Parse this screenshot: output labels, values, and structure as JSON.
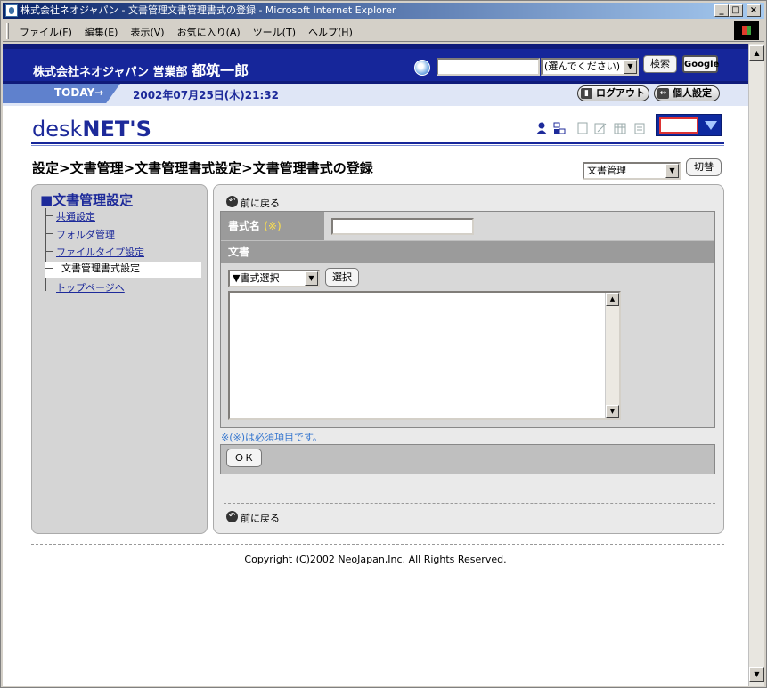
{
  "window": {
    "title": "株式会社ネオジャパン - 文書管理文書管理書式の登録 - Microsoft Internet Explorer",
    "minimize": "_",
    "maximize": "□",
    "close": "×"
  },
  "menubar": {
    "items": [
      "ファイル(F)",
      "編集(E)",
      "表示(V)",
      "お気に入り(A)",
      "ツール(T)",
      "ヘルプ(H)"
    ]
  },
  "header": {
    "company_dept": "株式会社ネオジャパン 営業部",
    "user_name": "都筑一郎",
    "search_select": "(選んでください)",
    "search_button": "検索",
    "google_button": "Google"
  },
  "todaybar": {
    "today_label": "TODAY→",
    "datetime": "2002年07月25日(木)21:32",
    "logout": "ログアウト",
    "personal": "個人設定"
  },
  "brand": {
    "logo_a": "desk",
    "logo_b": "NET'S"
  },
  "breadcrumb": "設定>文書管理>文書管理書式設定>文書管理書式の登録",
  "module_select": "文書管理",
  "switch_button": "切替",
  "sidebar": {
    "title": "■文書管理設定",
    "items": [
      {
        "label": "共通設定"
      },
      {
        "label": "フォルダ管理"
      },
      {
        "label": "ファイルタイプ設定"
      },
      {
        "label": "文書管理書式設定"
      },
      {
        "label": "トップページへ"
      }
    ]
  },
  "main": {
    "back_label": "前に戻る",
    "name_label": "書式名",
    "required_mark": "(※)",
    "doc_label": "文書",
    "format_select": "▼書式選択",
    "select_button": "選択",
    "required_note": "※(※)は必須項目です。",
    "ok_button": "ＯＫ"
  },
  "footer": {
    "copyright": "Copyright (C)2002 NeoJapan,Inc. All Rights Reserved."
  }
}
